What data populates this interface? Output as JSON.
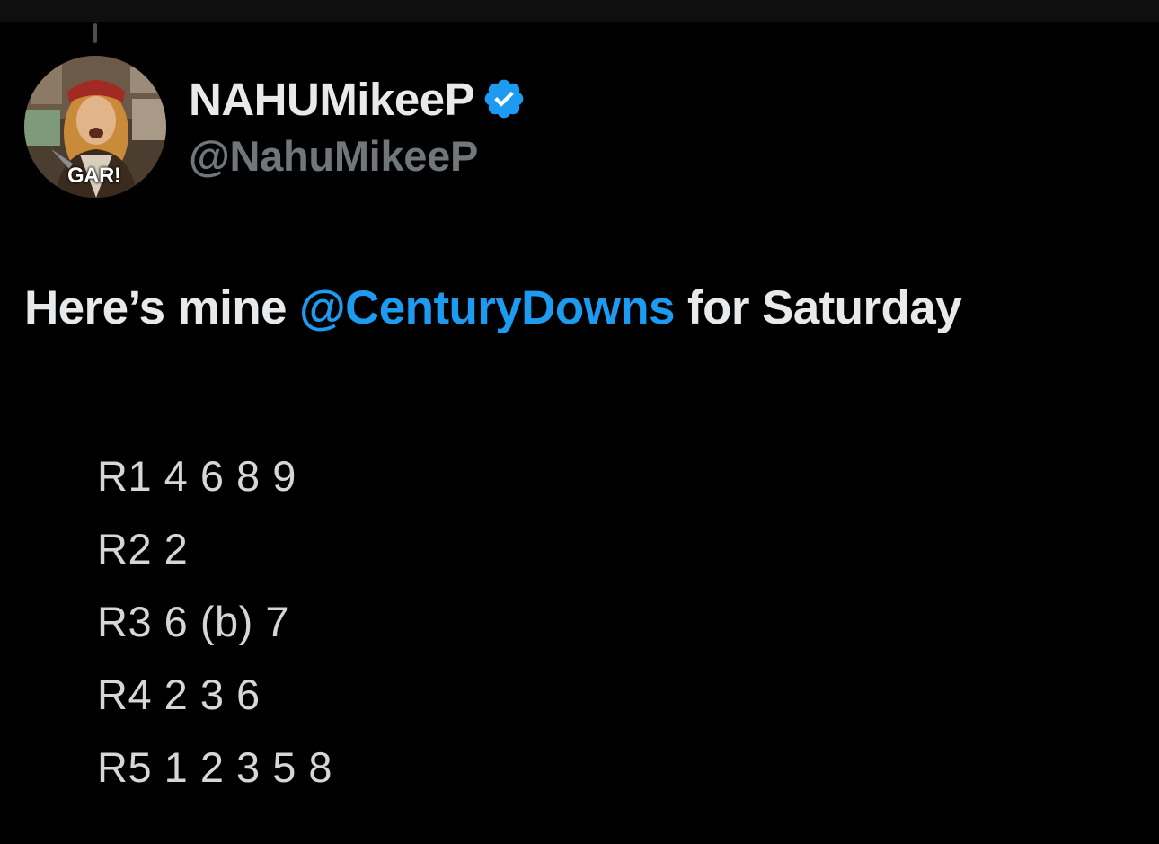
{
  "author": {
    "display_name": "NAHUMikeeP",
    "handle": "@NahuMikeeP",
    "verified": true,
    "avatar": {
      "badge_text": "GAR!"
    }
  },
  "tweet": {
    "text_before": "Here’s mine ",
    "mention": "@CenturyDowns",
    "text_after": " for Saturday",
    "picks": [
      "R1 4 6 8 9",
      "R2 2",
      "R3 6 (b) 7",
      "R4 2 3 6",
      "R5 1 2 3 5 8"
    ]
  },
  "colors": {
    "background": "#000000",
    "primary_text": "#e7e9ea",
    "secondary_text": "#71767b",
    "accent": "#1d9bf0"
  },
  "icons": {
    "verified": "verified-badge-icon",
    "avatar": "profile-photo"
  }
}
